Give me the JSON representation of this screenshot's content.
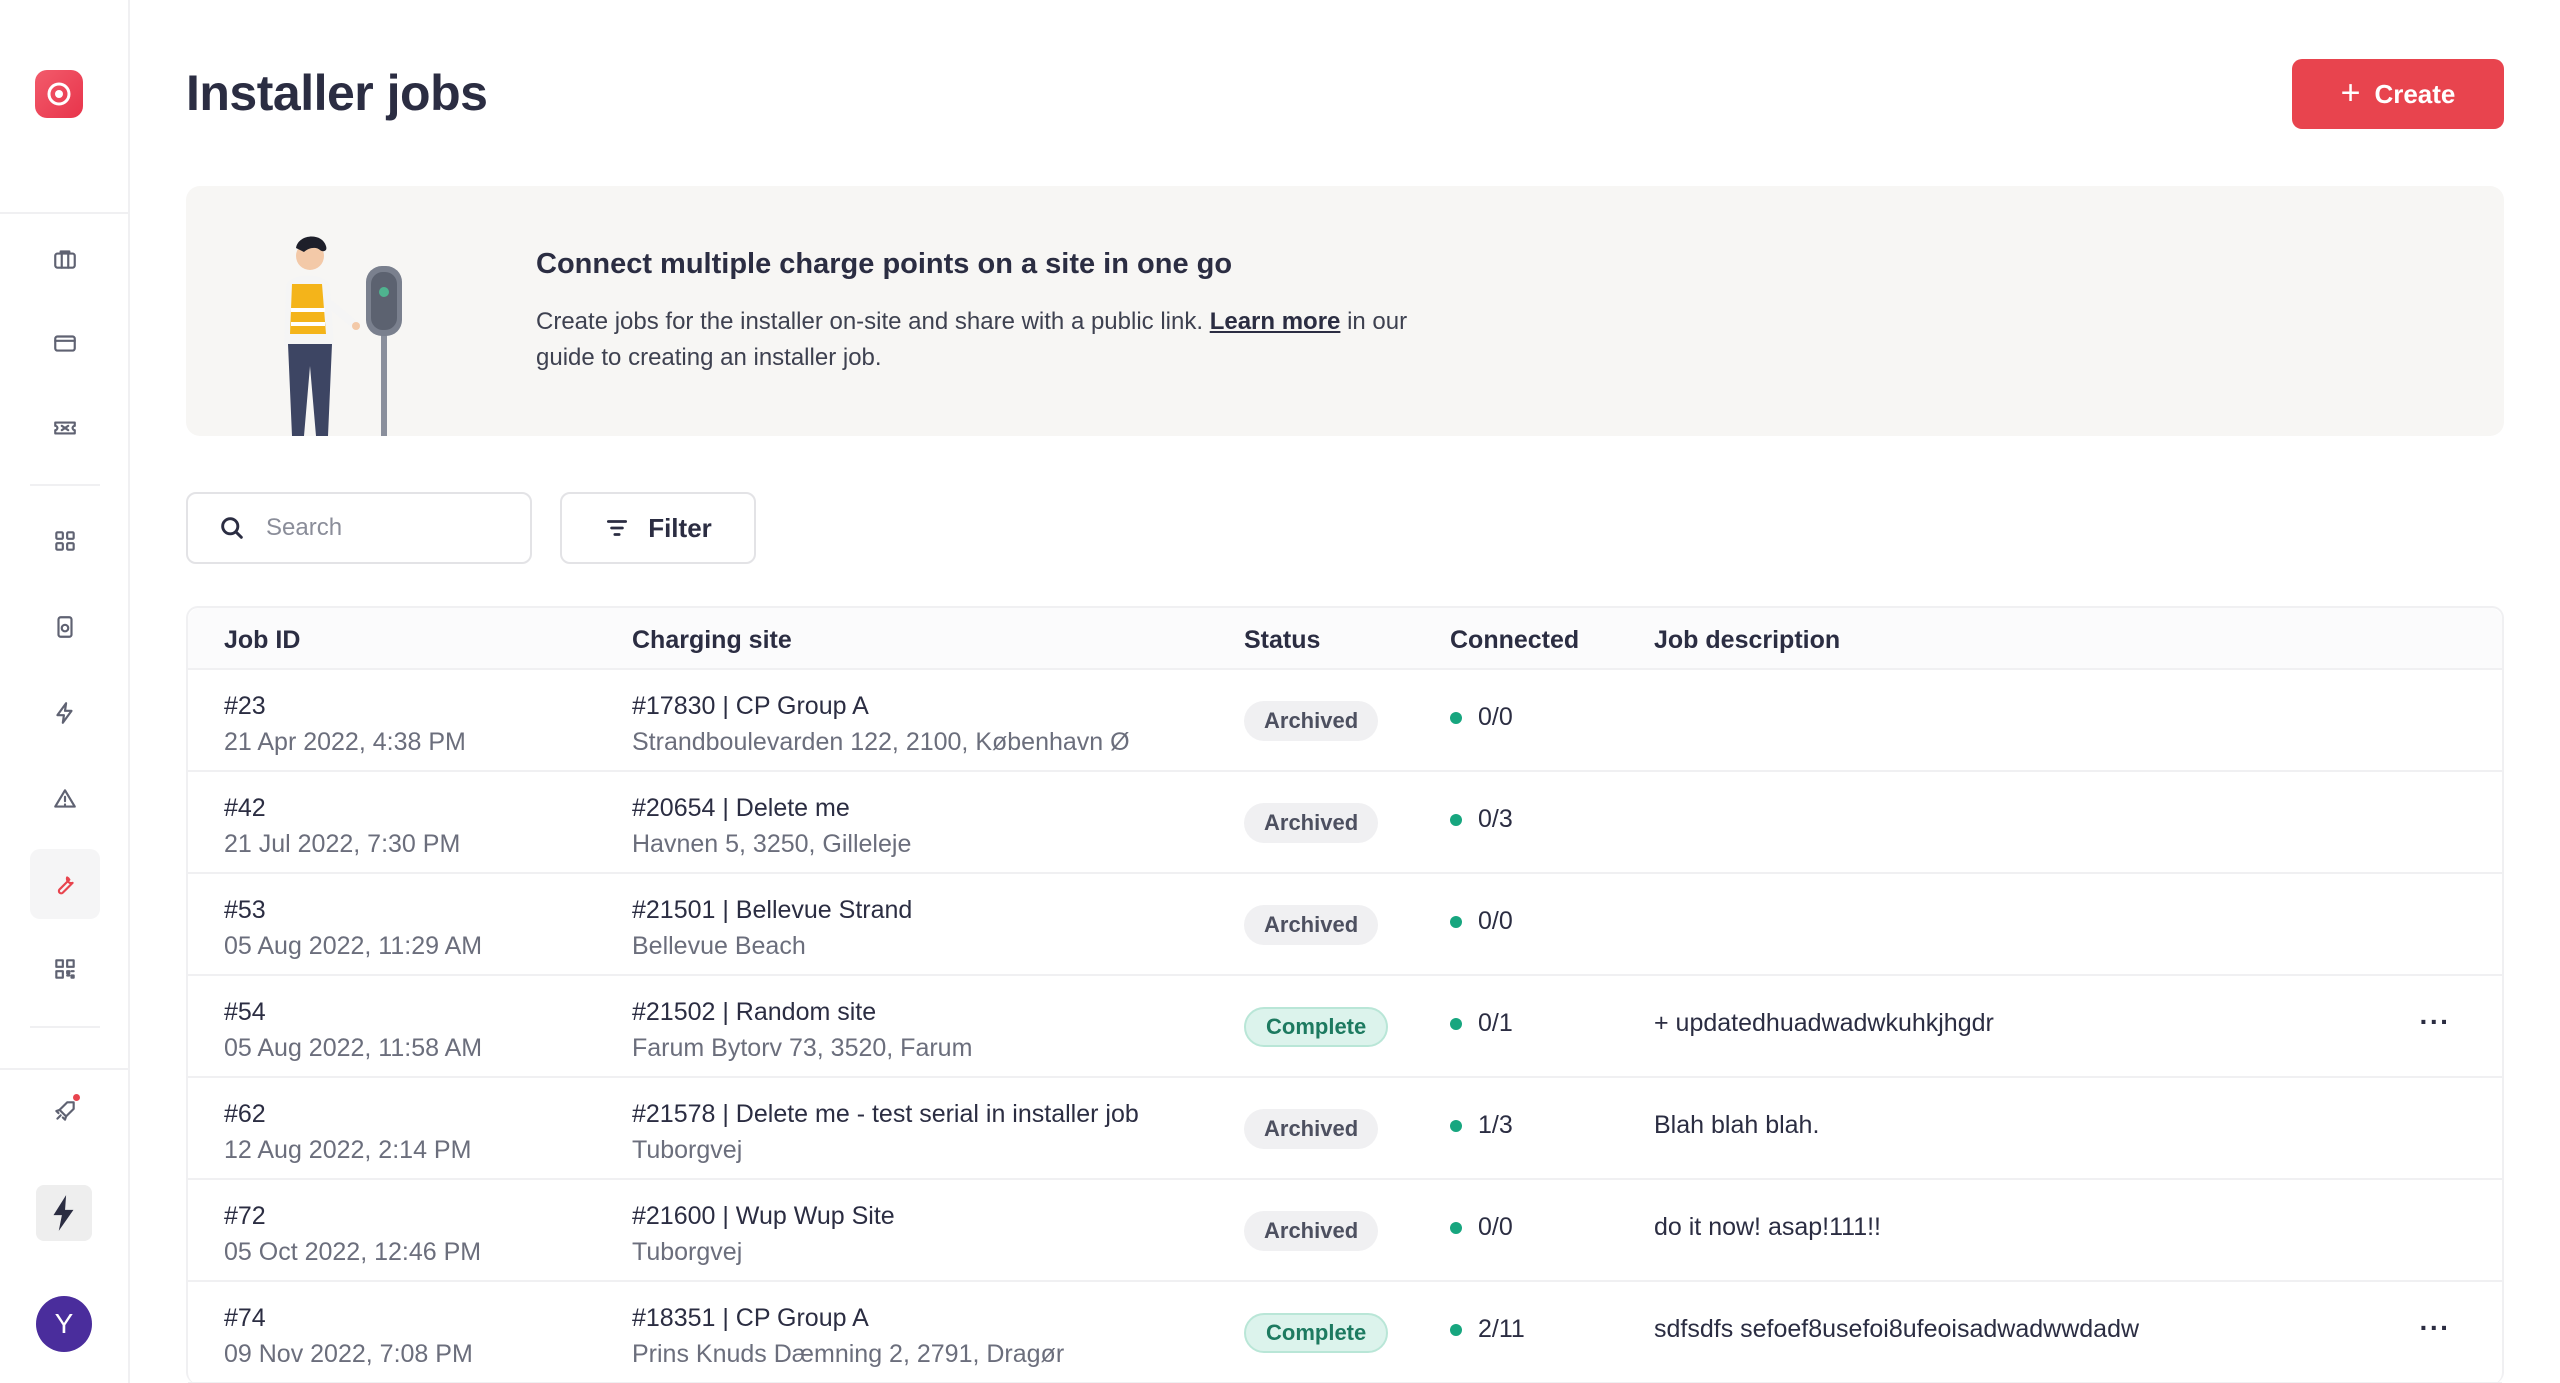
{
  "page": {
    "title": "Installer jobs"
  },
  "header": {
    "create_label": "Create"
  },
  "banner": {
    "title": "Connect multiple charge points on a site in one go",
    "text_before": "Create jobs for the installer on-site and share with a public link. ",
    "link_text": "Learn more",
    "text_after": " in our guide to creating an installer job."
  },
  "search": {
    "placeholder": "Search",
    "value": ""
  },
  "filter": {
    "label": "Filter"
  },
  "sidebar": {
    "avatar_initial": "Y",
    "items": [
      {
        "icon": "briefcase-icon"
      },
      {
        "icon": "credit-card-icon"
      },
      {
        "icon": "ticket-icon"
      },
      {
        "icon": "grid-icon"
      },
      {
        "icon": "charger-icon"
      },
      {
        "icon": "lightning-icon"
      },
      {
        "icon": "alert-icon"
      },
      {
        "icon": "wrench-icon",
        "active": true
      },
      {
        "icon": "qr-code-icon"
      },
      {
        "icon": "rocket-icon"
      }
    ]
  },
  "table": {
    "columns": [
      "Job ID",
      "Charging site",
      "Status",
      "Connected",
      "Job description"
    ],
    "rows": [
      {
        "id": "#23",
        "date": "21 Apr 2022, 4:38 PM",
        "site": "#17830 | CP Group A",
        "address": "Strandboulevarden 122, 2100, København Ø",
        "status": "Archived",
        "connected": "0/0",
        "description": ""
      },
      {
        "id": "#42",
        "date": "21 Jul 2022, 7:30 PM",
        "site": "#20654 | Delete me",
        "address": "Havnen 5, 3250, Gilleleje",
        "status": "Archived",
        "connected": "0/3",
        "description": ""
      },
      {
        "id": "#53",
        "date": "05 Aug 2022, 11:29 AM",
        "site": "#21501 | Bellevue Strand",
        "address": "Bellevue Beach",
        "status": "Archived",
        "connected": "0/0",
        "description": ""
      },
      {
        "id": "#54",
        "date": "05 Aug 2022, 11:58 AM",
        "site": "#21502 | Random site",
        "address": "Farum Bytorv 73, 3520, Farum",
        "status": "Complete",
        "connected": "0/1",
        "description": "+ updatedhuadwadwkuhkjhgdr",
        "more": "···"
      },
      {
        "id": "#62",
        "date": "12 Aug 2022, 2:14 PM",
        "site": "#21578 | Delete me - test serial in installer job",
        "address": "Tuborgvej",
        "status": "Archived",
        "connected": "1/3",
        "description": "Blah blah blah."
      },
      {
        "id": "#72",
        "date": "05 Oct 2022, 12:46 PM",
        "site": "#21600 | Wup Wup Site",
        "address": "Tuborgvej",
        "status": "Archived",
        "connected": "0/0",
        "description": "do it now! asap!111!!"
      },
      {
        "id": "#74",
        "date": "09 Nov 2022, 7:08 PM",
        "site": "#18351 | CP Group A",
        "address": "Prins Knuds Dæmning 2, 2791, Dragør",
        "status": "Complete",
        "connected": "2/11",
        "description": "sdfsdfs sefoef8usefoi8ufeoisadwadwwdadw",
        "more": "···"
      }
    ]
  },
  "colors": {
    "accent": "#e8444e",
    "connected_dot": "#17a67f",
    "complete_bg": "#dcf3ec",
    "archived_bg": "#f0f0f2"
  }
}
